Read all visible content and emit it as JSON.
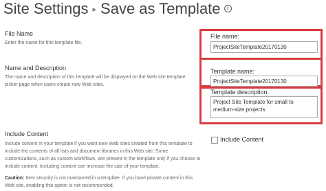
{
  "header": {
    "breadcrumb_root": "Site Settings",
    "separator": "▸",
    "page_title": "Save as Template",
    "info_glyph": "i"
  },
  "sections": {
    "file_name": {
      "heading": "File Name",
      "description": "Enter the name for this template file.",
      "field_label": "File name:",
      "field_value": "ProjectSiteTemplate20170130"
    },
    "name_description": {
      "heading": "Name and Description",
      "description_line1": "The name and description of this template will be displayed on the Web site template",
      "description_line2": "picker page when users create new Web sites.",
      "template_name_label": "Template name:",
      "template_name_value": "ProjectSiteTemplate20170130",
      "template_description_label": "Template description:",
      "template_description_value": "Project Site Template for small to medium-size projects"
    },
    "include_content": {
      "heading": "Include Content",
      "description_lines": [
        "Include content in your template if you want new Web sites created from this template to",
        "include the contents of all lists and document libraries in this Web site. Some",
        "customizations, such as custom workflows, are present in the template only if you choose to",
        "include content. Including content can increase the size of your template."
      ],
      "checkbox_label": "Include Content",
      "caution_bold": "Caution:",
      "caution_line1": " Item security is not maintained in a template. If you have private content in this",
      "caution_line2": "Web site, enabling this option is not recommended."
    }
  },
  "colors": {
    "highlight_border": "#d93b41",
    "input_border": "#ababab"
  }
}
